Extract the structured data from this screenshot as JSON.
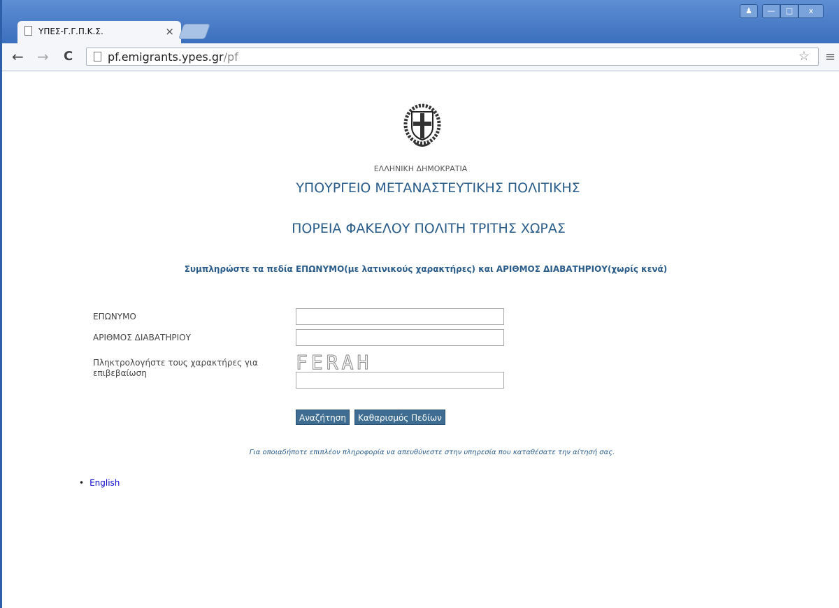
{
  "browser": {
    "tab_title": "ΥΠΕΣ-Γ.Γ.Π.Κ.Σ.",
    "tab_close": "×",
    "url_host": "pf.emigrants.ypes.gr",
    "url_path": "/pf",
    "window_buttons": [
      "user",
      "minimize",
      "maximize",
      "close"
    ]
  },
  "header": {
    "country": "ΕΛΛΗΝΙΚΗ ΔΗΜΟΚΡΑΤΙΑ",
    "ministry": "ΥΠΟΥΡΓΕΙΟ ΜΕΤΑΝΑΣΤΕΥΤΙΚΗΣ ΠΟΛΙΤΙΚΗΣ",
    "service": "ΠΟΡΕΙΑ ΦΑΚΕΛΟΥ ΠΟΛΙΤΗ ΤΡΙΤΗΣ ΧΩΡΑΣ"
  },
  "form": {
    "instructions": "Συμπληρώστε τα πεδία ΕΠΩΝΥΜΟ(με λατινικούς χαρακτήρες) και ΑΡΙΘΜΟΣ ΔΙΑΒΑΤΗΡΙΟΥ(χωρίς κενά)",
    "surname_label": "ΕΠΩΝΥΜΟ",
    "surname_value": "",
    "passport_label": "ΑΡΙΘΜΟΣ ΔΙΑΒΑΤΗΡΙΟΥ",
    "passport_value": "",
    "captcha_label": "Πληκτρολογήστε τους χαρακτήρες για επιβεβαίωση",
    "captcha_text": "FERAH",
    "captcha_value": "",
    "search_button": "Αναζήτηση",
    "clear_button": "Καθαρισμός Πεδίων"
  },
  "footer": {
    "info": "Για οποιαδήποτε επιπλέον πληροφορία να απευθύνεστε στην υπηρεσία που καταθέσατε την αίτησή σας.",
    "language_link": "English"
  }
}
